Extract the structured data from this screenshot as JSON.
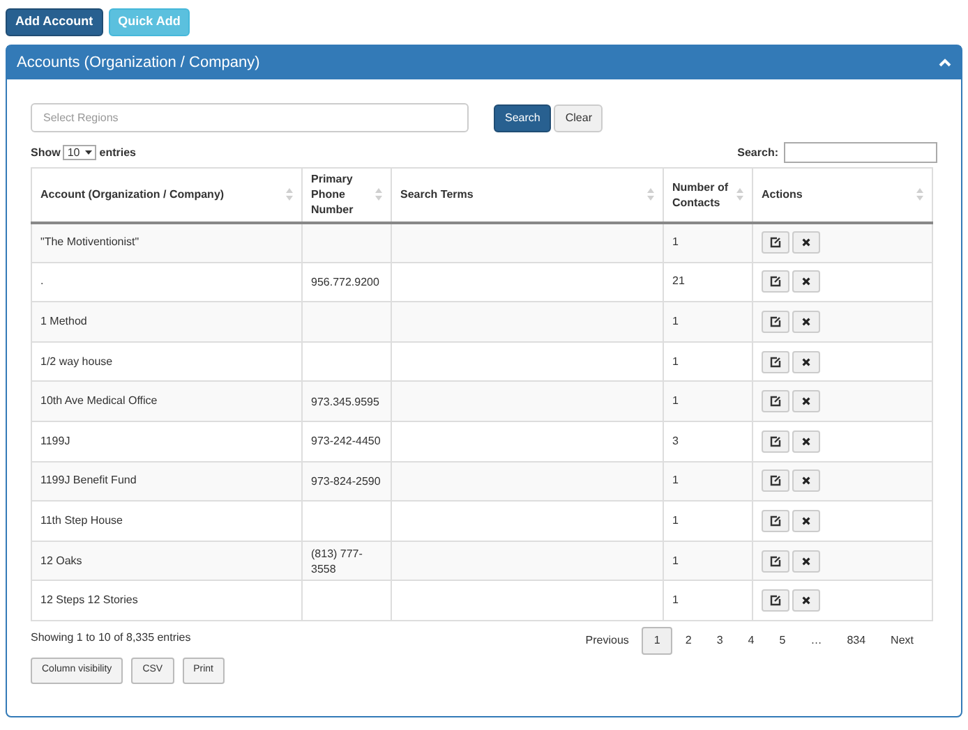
{
  "top_buttons": [
    "Add Account",
    "Quick Add"
  ],
  "panel": {
    "title": "Accounts (Organization / Company)",
    "expanded": true
  },
  "filter": {
    "placeholder": "Select Regions",
    "search_button": "Search",
    "clear_button": "Clear"
  },
  "length": {
    "prefix": "Show",
    "value": "10",
    "suffix": "entries"
  },
  "search_label": "Search:",
  "table": {
    "columns": [
      "Account (Organization / Company)",
      "Primary Phone Number",
      "Search Terms",
      "Number of Contacts",
      "Actions"
    ],
    "rows": [
      {
        "account": "\"The Motiventionist\"",
        "phone": "",
        "terms": "",
        "contacts": "1"
      },
      {
        "account": ".",
        "phone": "956.772.9200",
        "terms": "",
        "contacts": "21"
      },
      {
        "account": "1 Method",
        "phone": "",
        "terms": "",
        "contacts": "1"
      },
      {
        "account": "1/2 way house",
        "phone": "",
        "terms": "",
        "contacts": "1"
      },
      {
        "account": "10th Ave Medical Office",
        "phone": "973.345.9595",
        "terms": "",
        "contacts": "1"
      },
      {
        "account": "1199J",
        "phone": "973-242-4450",
        "terms": "",
        "contacts": "3"
      },
      {
        "account": "1199J Benefit Fund",
        "phone": "973-824-2590",
        "terms": "",
        "contacts": "1"
      },
      {
        "account": "11th Step House",
        "phone": "",
        "terms": "",
        "contacts": "1"
      },
      {
        "account": "12 Oaks",
        "phone": "(813) 777-3558",
        "terms": "",
        "contacts": "1"
      },
      {
        "account": "12 Steps 12 Stories",
        "phone": "",
        "terms": "",
        "contacts": "1"
      }
    ]
  },
  "info": "Showing 1 to 10 of 8,335 entries",
  "pagination": [
    {
      "label": "Previous",
      "selected": false
    },
    {
      "label": "1",
      "selected": true
    },
    {
      "label": "2",
      "selected": false
    },
    {
      "label": "3",
      "selected": false
    },
    {
      "label": "4",
      "selected": false
    },
    {
      "label": "5",
      "selected": false
    },
    {
      "label": "…",
      "selected": false
    },
    {
      "label": "834",
      "selected": false
    },
    {
      "label": "Next",
      "selected": false
    }
  ],
  "export_buttons": [
    "Column visibility",
    "CSV",
    "Print"
  ]
}
